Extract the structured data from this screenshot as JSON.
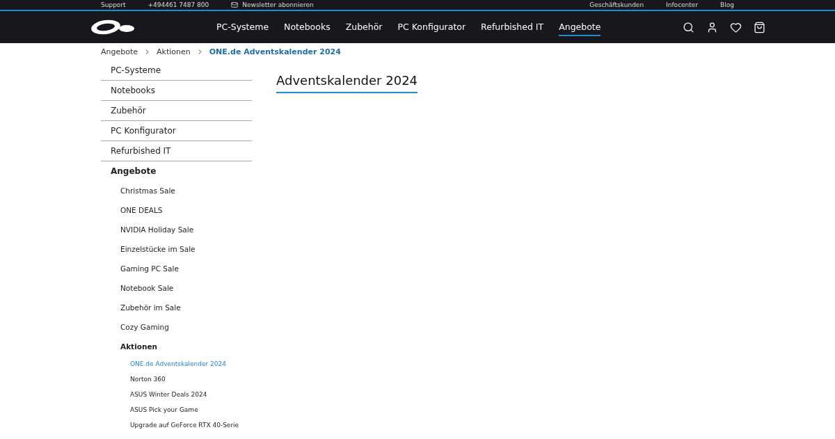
{
  "top_bar": {
    "left": [
      {
        "kind": "text",
        "label": "Support"
      },
      {
        "kind": "text",
        "label": "+494461 7487 800"
      },
      {
        "kind": "mail",
        "label": "Newsletter abonnieren"
      }
    ],
    "right": [
      "Geschäftskunden",
      "Infocenter",
      "Blog"
    ]
  },
  "nav": {
    "items": [
      {
        "label": "PC-Systeme",
        "selected": false
      },
      {
        "label": "Notebooks",
        "selected": false
      },
      {
        "label": "Zubehör",
        "selected": false
      },
      {
        "label": "PC Konfigurator",
        "selected": false
      },
      {
        "label": "Refurbished IT",
        "selected": false
      },
      {
        "label": "Angebote",
        "selected": true
      }
    ]
  },
  "breadcrumb": [
    "Angebote",
    "Aktionen",
    "ONE.de Adventskalender 2024"
  ],
  "sidebar": {
    "items": [
      {
        "label": "PC-Systeme",
        "selected": false
      },
      {
        "label": "Notebooks",
        "selected": false
      },
      {
        "label": "Zubehör",
        "selected": false
      },
      {
        "label": "PC Konfigurator",
        "selected": false
      },
      {
        "label": "Refurbished IT",
        "selected": false
      },
      {
        "label": "Angebote",
        "selected": true,
        "children": [
          {
            "label": "Christmas Sale",
            "selected": false
          },
          {
            "label": "ONE DEALS",
            "selected": false
          },
          {
            "label": "NVIDIA Holiday Sale",
            "selected": false
          },
          {
            "label": "Einzelstücke im Sale",
            "selected": false
          },
          {
            "label": "Gaming PC Sale",
            "selected": false
          },
          {
            "label": "Notebook Sale",
            "selected": false
          },
          {
            "label": "Zubehör im Sale",
            "selected": false
          },
          {
            "label": "Cozy Gaming",
            "selected": false
          },
          {
            "label": "Aktionen",
            "selected": true,
            "children": [
              {
                "label": "ONE.de Adventskalender 2024",
                "selected": true
              },
              {
                "label": "Norton 360",
                "selected": false
              },
              {
                "label": "ASUS Winter Deals 2024",
                "selected": false
              },
              {
                "label": "ASUS Pick your Game",
                "selected": false
              },
              {
                "label": "Upgrade auf GeForce RTX 40-Serie",
                "selected": false
              }
            ]
          }
        ]
      }
    ]
  },
  "page_title": "Adventskalender 2024"
}
